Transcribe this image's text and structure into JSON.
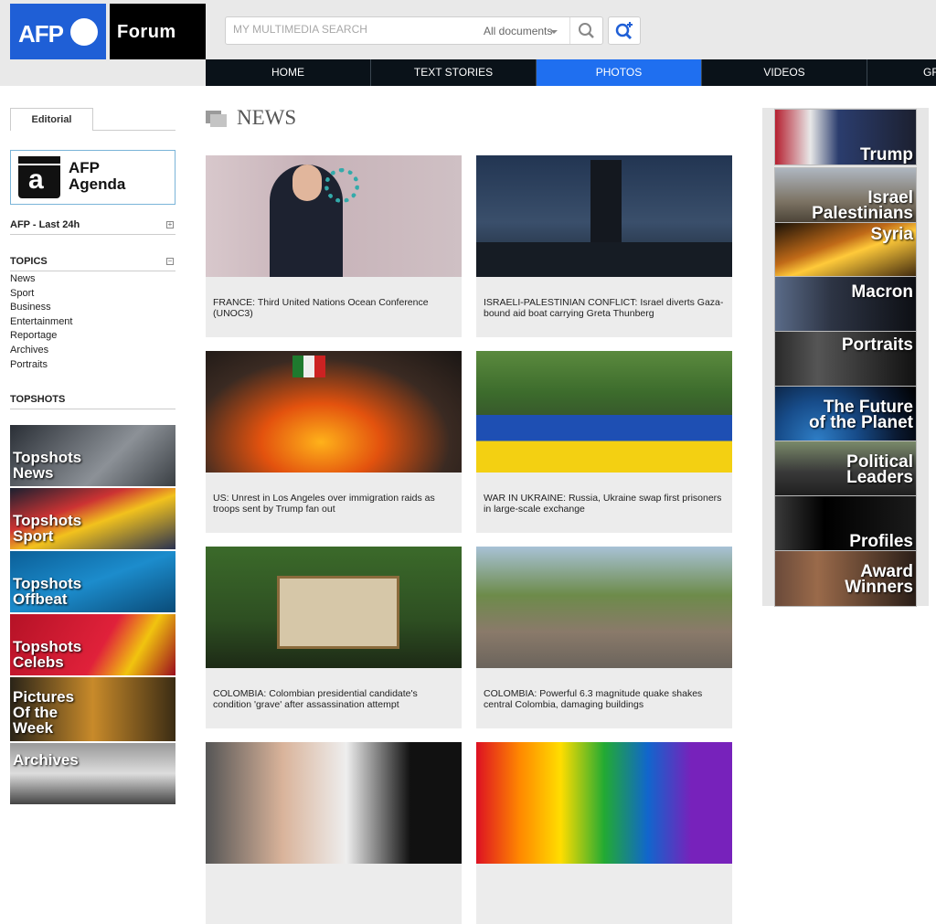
{
  "brand": {
    "afp": "AFP",
    "forum": "Forum",
    "blue": "#1f5fd6"
  },
  "search": {
    "placeholder": "MY MULTIMEDIA SEARCH",
    "scope": "All documents",
    "icon": "search-icon",
    "advanced_icon": "search-plus-icon"
  },
  "nav": {
    "items": [
      "HOME",
      "TEXT STORIES",
      "PHOTOS",
      "VIDEOS",
      "GR"
    ],
    "active": "PHOTOS",
    "active_color": "#1f6ff0"
  },
  "sidebar": {
    "tab": "Editorial",
    "agenda": "AFP\nAgenda",
    "last24": "AFP - Last 24h",
    "topics_title": "TOPICS",
    "topics": [
      "News",
      "Sport",
      "Business",
      "Entertainment",
      "Reportage",
      "Archives",
      "Portraits"
    ],
    "topshots_title": "TOPSHOTS",
    "tiles": [
      "Topshots\nNews",
      "Topshots\nSport",
      "Topshots\nOffbeat",
      "Topshots\nCelebs",
      "Pictures\nOf the\nWeek",
      "Archives"
    ]
  },
  "main": {
    "title": "NEWS",
    "cards": [
      {
        "caption": "FRANCE: Third United Nations Ocean Conference (UNOC3)"
      },
      {
        "caption": "ISRAELI-PALESTINIAN CONFLICT: Israel diverts Gaza-bound aid boat carrying Greta Thunberg"
      },
      {
        "caption": "US: Unrest in Los Angeles over immigration raids as troops sent by Trump fan out"
      },
      {
        "caption": "WAR IN UKRAINE: Russia, Ukraine swap first prisoners in large-scale exchange"
      },
      {
        "caption": "COLOMBIA: Colombian presidential candidate's condition 'grave' after assassination attempt"
      },
      {
        "caption": "COLOMBIA: Powerful 6.3 magnitude quake shakes central Colombia, damaging buildings"
      }
    ]
  },
  "rightbar": {
    "tiles": [
      "Trump",
      "Israel\nPalestinians",
      "Syria",
      "Macron",
      "Portraits",
      "The Future\nof the Planet",
      "Political\nLeaders",
      "Profiles",
      "Award\nWinners"
    ]
  }
}
